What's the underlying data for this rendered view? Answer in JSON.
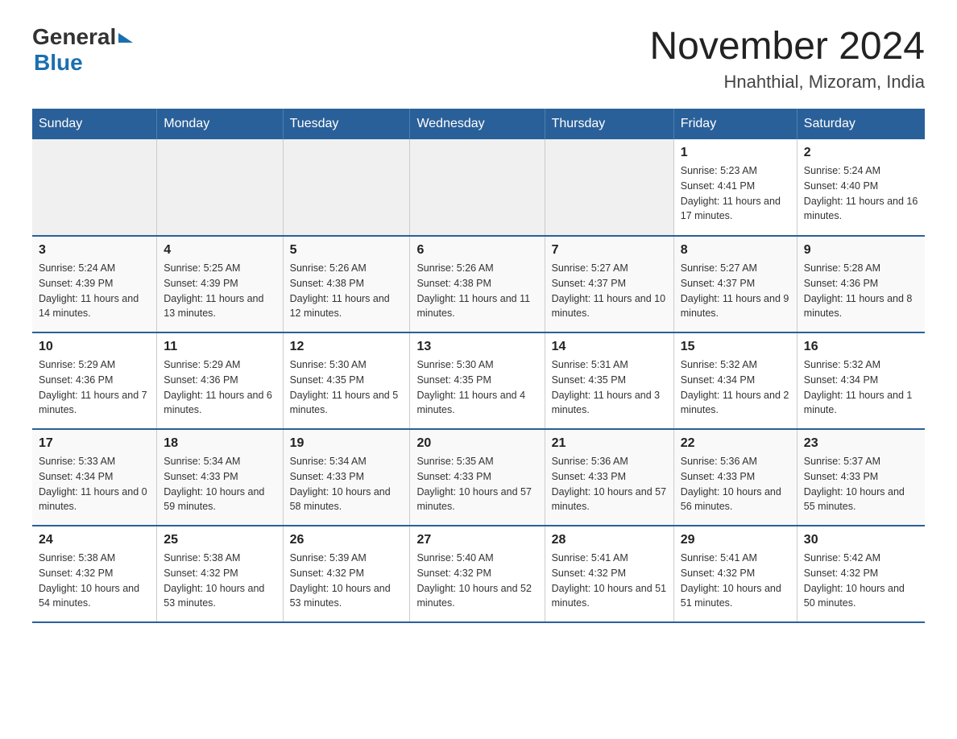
{
  "header": {
    "logo_general": "General",
    "logo_blue": "Blue",
    "title": "November 2024",
    "subtitle": "Hnahthial, Mizoram, India"
  },
  "weekdays": [
    "Sunday",
    "Monday",
    "Tuesday",
    "Wednesday",
    "Thursday",
    "Friday",
    "Saturday"
  ],
  "weeks": [
    [
      {
        "day": "",
        "info": ""
      },
      {
        "day": "",
        "info": ""
      },
      {
        "day": "",
        "info": ""
      },
      {
        "day": "",
        "info": ""
      },
      {
        "day": "",
        "info": ""
      },
      {
        "day": "1",
        "info": "Sunrise: 5:23 AM\nSunset: 4:41 PM\nDaylight: 11 hours and 17 minutes."
      },
      {
        "day": "2",
        "info": "Sunrise: 5:24 AM\nSunset: 4:40 PM\nDaylight: 11 hours and 16 minutes."
      }
    ],
    [
      {
        "day": "3",
        "info": "Sunrise: 5:24 AM\nSunset: 4:39 PM\nDaylight: 11 hours and 14 minutes."
      },
      {
        "day": "4",
        "info": "Sunrise: 5:25 AM\nSunset: 4:39 PM\nDaylight: 11 hours and 13 minutes."
      },
      {
        "day": "5",
        "info": "Sunrise: 5:26 AM\nSunset: 4:38 PM\nDaylight: 11 hours and 12 minutes."
      },
      {
        "day": "6",
        "info": "Sunrise: 5:26 AM\nSunset: 4:38 PM\nDaylight: 11 hours and 11 minutes."
      },
      {
        "day": "7",
        "info": "Sunrise: 5:27 AM\nSunset: 4:37 PM\nDaylight: 11 hours and 10 minutes."
      },
      {
        "day": "8",
        "info": "Sunrise: 5:27 AM\nSunset: 4:37 PM\nDaylight: 11 hours and 9 minutes."
      },
      {
        "day": "9",
        "info": "Sunrise: 5:28 AM\nSunset: 4:36 PM\nDaylight: 11 hours and 8 minutes."
      }
    ],
    [
      {
        "day": "10",
        "info": "Sunrise: 5:29 AM\nSunset: 4:36 PM\nDaylight: 11 hours and 7 minutes."
      },
      {
        "day": "11",
        "info": "Sunrise: 5:29 AM\nSunset: 4:36 PM\nDaylight: 11 hours and 6 minutes."
      },
      {
        "day": "12",
        "info": "Sunrise: 5:30 AM\nSunset: 4:35 PM\nDaylight: 11 hours and 5 minutes."
      },
      {
        "day": "13",
        "info": "Sunrise: 5:30 AM\nSunset: 4:35 PM\nDaylight: 11 hours and 4 minutes."
      },
      {
        "day": "14",
        "info": "Sunrise: 5:31 AM\nSunset: 4:35 PM\nDaylight: 11 hours and 3 minutes."
      },
      {
        "day": "15",
        "info": "Sunrise: 5:32 AM\nSunset: 4:34 PM\nDaylight: 11 hours and 2 minutes."
      },
      {
        "day": "16",
        "info": "Sunrise: 5:32 AM\nSunset: 4:34 PM\nDaylight: 11 hours and 1 minute."
      }
    ],
    [
      {
        "day": "17",
        "info": "Sunrise: 5:33 AM\nSunset: 4:34 PM\nDaylight: 11 hours and 0 minutes."
      },
      {
        "day": "18",
        "info": "Sunrise: 5:34 AM\nSunset: 4:33 PM\nDaylight: 10 hours and 59 minutes."
      },
      {
        "day": "19",
        "info": "Sunrise: 5:34 AM\nSunset: 4:33 PM\nDaylight: 10 hours and 58 minutes."
      },
      {
        "day": "20",
        "info": "Sunrise: 5:35 AM\nSunset: 4:33 PM\nDaylight: 10 hours and 57 minutes."
      },
      {
        "day": "21",
        "info": "Sunrise: 5:36 AM\nSunset: 4:33 PM\nDaylight: 10 hours and 57 minutes."
      },
      {
        "day": "22",
        "info": "Sunrise: 5:36 AM\nSunset: 4:33 PM\nDaylight: 10 hours and 56 minutes."
      },
      {
        "day": "23",
        "info": "Sunrise: 5:37 AM\nSunset: 4:33 PM\nDaylight: 10 hours and 55 minutes."
      }
    ],
    [
      {
        "day": "24",
        "info": "Sunrise: 5:38 AM\nSunset: 4:32 PM\nDaylight: 10 hours and 54 minutes."
      },
      {
        "day": "25",
        "info": "Sunrise: 5:38 AM\nSunset: 4:32 PM\nDaylight: 10 hours and 53 minutes."
      },
      {
        "day": "26",
        "info": "Sunrise: 5:39 AM\nSunset: 4:32 PM\nDaylight: 10 hours and 53 minutes."
      },
      {
        "day": "27",
        "info": "Sunrise: 5:40 AM\nSunset: 4:32 PM\nDaylight: 10 hours and 52 minutes."
      },
      {
        "day": "28",
        "info": "Sunrise: 5:41 AM\nSunset: 4:32 PM\nDaylight: 10 hours and 51 minutes."
      },
      {
        "day": "29",
        "info": "Sunrise: 5:41 AM\nSunset: 4:32 PM\nDaylight: 10 hours and 51 minutes."
      },
      {
        "day": "30",
        "info": "Sunrise: 5:42 AM\nSunset: 4:32 PM\nDaylight: 10 hours and 50 minutes."
      }
    ]
  ]
}
